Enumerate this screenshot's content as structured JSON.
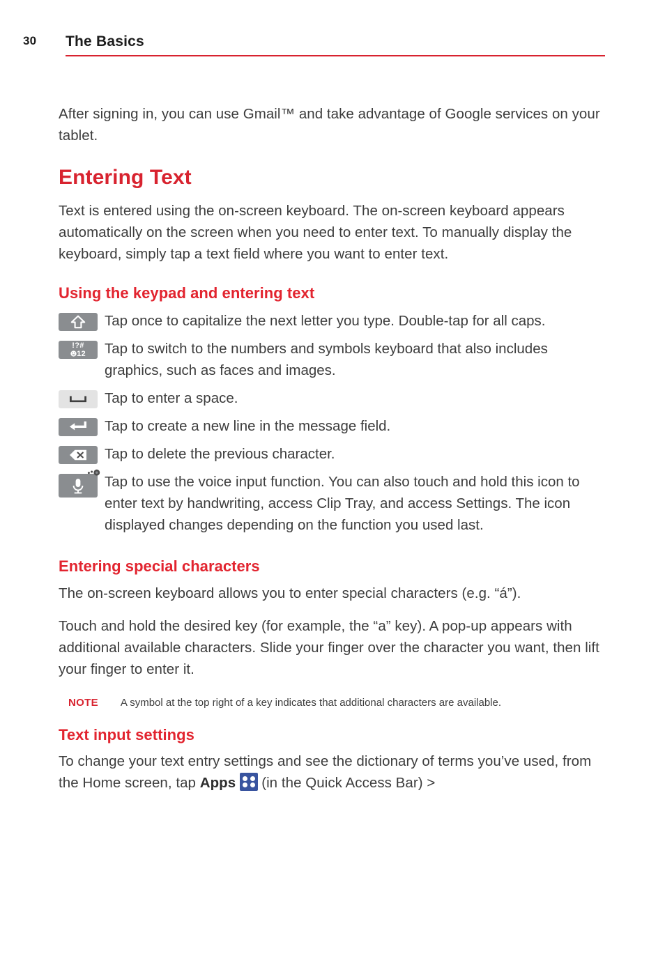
{
  "header": {
    "page_number": "30",
    "title": "The Basics",
    "rule_color": "#d8232f"
  },
  "colors": {
    "accent_red": "#d8232f",
    "heading_red": "#e2242f",
    "body_text": "#3d3d3d",
    "keycap_gray": "#8a8d90",
    "keycap_light_gray": "#e3e3e3",
    "apps_icon_blue": "#39549f"
  },
  "intro": {
    "paragraph": "After signing in, you can use Gmail™ and take advantage of Google services on your tablet."
  },
  "entering_text": {
    "heading": "Entering Text",
    "paragraph": "Text is entered using the on-screen keyboard. The on-screen keyboard appears automatically on the screen when you need to enter text. To manually display the keyboard, simply tap a text field where you want to enter text."
  },
  "using_keypad": {
    "heading": "Using the keypad and entering text",
    "keys": [
      {
        "icon": "shift-key-icon",
        "description": "Tap once to capitalize the next letter you type. Double-tap for all caps."
      },
      {
        "icon": "symbols-key-icon",
        "label_top": "!?#",
        "label_bottom": "12",
        "description": "Tap to switch to the numbers and symbols keyboard that also includes graphics, such as faces and images."
      },
      {
        "icon": "space-key-icon",
        "description": "Tap to enter a space."
      },
      {
        "icon": "enter-key-icon",
        "description": "Tap to create a new line in the message field."
      },
      {
        "icon": "backspace-key-icon",
        "description": "Tap to delete the previous character."
      },
      {
        "icon": "microphone-key-icon",
        "description": "Tap to use the voice input function. You can also touch and hold this icon to enter text by handwriting, access Clip Tray, and access Settings. The icon displayed changes depending on the function you used last."
      }
    ]
  },
  "special_characters": {
    "heading": "Entering special characters",
    "paragraph_1": "The on-screen keyboard allows you to enter special characters (e.g. “á”).",
    "paragraph_2": "Touch and hold the desired key (for example, the “a” key). A pop-up appears with additional available characters. Slide your finger over the character you want, then lift your finger to enter it.",
    "note_label": "NOTE",
    "note_text": "A symbol at the top right of a key indicates that additional characters are available."
  },
  "text_input_settings": {
    "heading": "Text input settings",
    "line_1": "To change your text entry settings and see the dictionary of terms you’ve",
    "line_2_before": "used, from the Home screen, tap ",
    "apps_label": "Apps",
    "apps_icon": "apps-grid-icon",
    "line_2_after": "(in the Quick Access Bar) >"
  }
}
